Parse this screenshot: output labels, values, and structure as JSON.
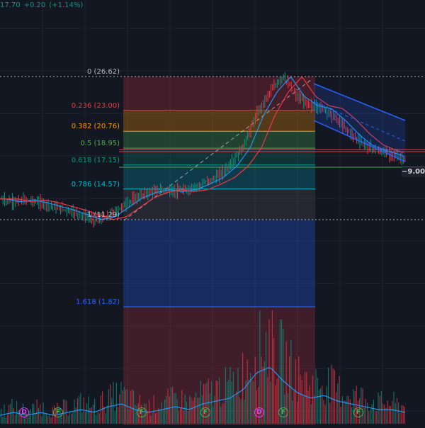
{
  "header": {
    "last_price": "17.70",
    "change": "+0.20",
    "change_pct": "(+1.14%)",
    "color": "#089981"
  },
  "fib_levels": [
    {
      "level": "0",
      "price": "26.62",
      "label": "0 (26.62)",
      "color": "#b2b5be"
    },
    {
      "level": "0.236",
      "price": "23.00",
      "label": "0.236 (23.00)",
      "color": "#f23645"
    },
    {
      "level": "0.382",
      "price": "20.76",
      "label": "0.382 (20.76)",
      "color": "#ff9800"
    },
    {
      "level": "0.5",
      "price": "18.95",
      "label": "0.5 (18.95)",
      "color": "#4caf50"
    },
    {
      "level": "0.618",
      "price": "17.15",
      "label": "0.618 (17.15)",
      "color": "#089981"
    },
    {
      "level": "0.786",
      "price": "14.57",
      "label": "0.786 (14.57)",
      "color": "#00bcd4"
    },
    {
      "level": "1",
      "price": "11.29",
      "label": "1 (11.29)",
      "color": "#b2b5be"
    },
    {
      "level": "1.618",
      "price": "1.82",
      "label": "1.618 (1.82)",
      "color": "#2962ff"
    }
  ],
  "price_axis": {
    "current_label": "9.00",
    "tag_prefix": "−"
  },
  "events": [
    {
      "type": "D",
      "color": "#e040fb"
    },
    {
      "type": "F",
      "color": "#4caf50"
    },
    {
      "type": "F",
      "color": "#4caf50"
    },
    {
      "type": "F",
      "color": "#4caf50"
    },
    {
      "type": "D",
      "color": "#e040fb"
    },
    {
      "type": "F",
      "color": "#4caf50"
    },
    {
      "type": "F",
      "color": "#4caf50"
    }
  ],
  "colors": {
    "background": "#131722",
    "up": "#089981",
    "down": "#f23645",
    "ma_fast": "#2196f3",
    "ma_slow": "#f23645",
    "channel": "#2962ff",
    "volume_ma": "#2196f3"
  },
  "chart_data": {
    "type": "candlestick",
    "title": "",
    "fib_retracement": {
      "high": 26.62,
      "low": 11.29
    },
    "price_path": [
      13.5,
      13.2,
      13.4,
      13.1,
      12.7,
      12.3,
      11.8,
      11.3,
      11.6,
      12.6,
      13.6,
      14.2,
      14.5,
      14.3,
      14.5,
      15.1,
      15.8,
      17.0,
      19.0,
      22.5,
      25.0,
      26.6,
      24.5,
      23.5,
      23.2,
      22.0,
      20.5,
      19.3,
      18.7,
      18.3,
      17.7
    ],
    "volume_path": [
      3,
      4,
      3,
      4,
      3,
      4,
      5,
      4,
      6,
      7,
      5,
      4,
      5,
      6,
      5,
      7,
      8,
      9,
      12,
      18,
      20,
      15,
      11,
      9,
      10,
      8,
      7,
      6,
      5,
      5,
      4
    ],
    "price_unit": ""
  }
}
